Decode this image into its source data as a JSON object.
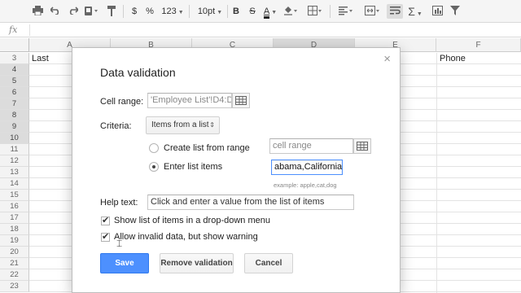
{
  "toolbar": {
    "zoom_format": "123",
    "currency": "$",
    "percent": "%",
    "font_size": "10pt",
    "bold": "B",
    "strike": "S",
    "text_color": "A"
  },
  "formula_bar": {
    "fx": "fx"
  },
  "grid": {
    "columns": [
      "A",
      "B",
      "C",
      "D",
      "E",
      "F"
    ],
    "rows": [
      "3",
      "4",
      "5",
      "6",
      "7",
      "8",
      "9",
      "10",
      "11",
      "12",
      "13",
      "14",
      "15",
      "16",
      "17",
      "18",
      "19",
      "20",
      "21",
      "22",
      "23"
    ],
    "cells": {
      "a3": "Last",
      "f3": "Phone"
    }
  },
  "dialog": {
    "title": "Data validation",
    "close": "×",
    "cell_range_label": "Cell range:",
    "cell_range_value": "'Employee List'!D4:D",
    "criteria_label": "Criteria:",
    "criteria_value": "Items from a list",
    "option_range_label": "Create list from range",
    "option_range_placeholder": "cell range",
    "option_items_label": "Enter list items",
    "option_items_value": "abama,California",
    "example": "example: apple,cat,dog",
    "help_text_label": "Help text:",
    "help_text_value": "Click and enter a value from the list of items",
    "show_dropdown_label": "Show list of items in a drop-down menu",
    "allow_invalid_label": "Allow invalid data, but show warning",
    "save_label": "Save",
    "remove_label": "Remove validation",
    "cancel_label": "Cancel"
  },
  "icons": [
    "print-icon",
    "undo-icon",
    "redo-icon",
    "paint-format-icon",
    "paint-roller-icon",
    "text-color-icon",
    "fill-color-icon",
    "borders-icon",
    "align-icon",
    "merge-icon",
    "wrap-icon",
    "sum-icon",
    "chart-icon",
    "filter-icon",
    "grid-icon",
    "cursor-icon"
  ]
}
